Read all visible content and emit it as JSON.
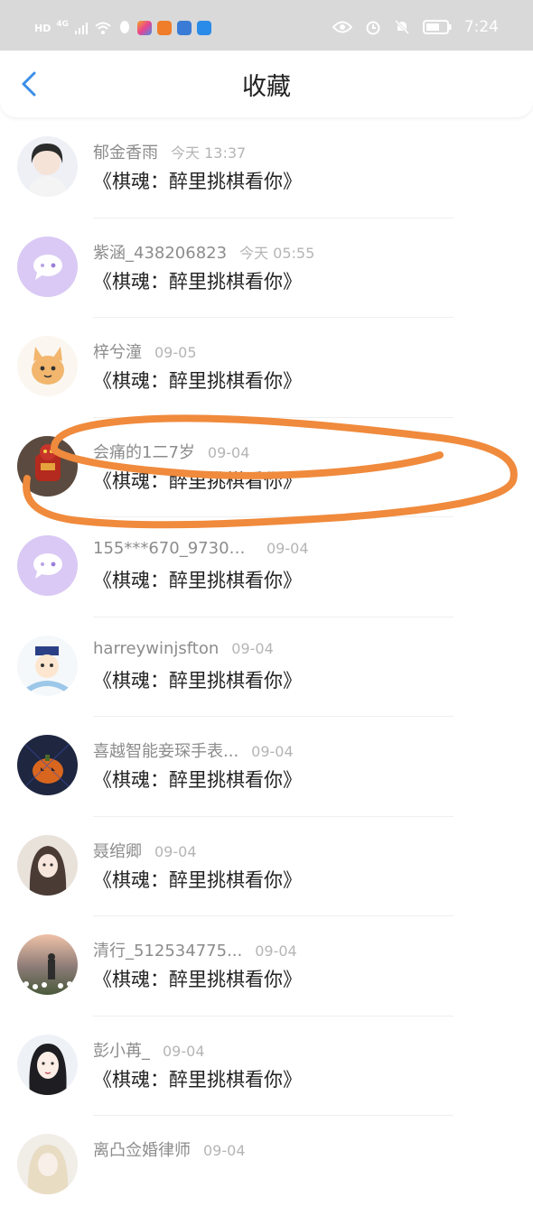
{
  "status_bar": {
    "left_labels": [
      "HD",
      "4G"
    ],
    "time": "7:24",
    "icons": [
      "signal-icon",
      "wifi-icon",
      "qq-icon",
      "app-icon",
      "video-icon",
      "music-icon",
      "weibo-icon",
      "eye-icon",
      "alarm-icon",
      "mute-icon",
      "battery-icon"
    ]
  },
  "header": {
    "title": "收藏"
  },
  "list": [
    {
      "name": "郁金香雨",
      "time": "今天 13:37",
      "content": "《棋魂：醉里挑棋看你》",
      "avatar": "photo-girl"
    },
    {
      "name": "紫涵_438206823",
      "time": "今天 05:55",
      "content": "《棋魂：醉里挑棋看你》",
      "avatar": "default"
    },
    {
      "name": "梓兮潼",
      "time": "09-05",
      "content": "《棋魂：醉里挑棋看你》",
      "avatar": "cat"
    },
    {
      "name": "会痛的1二7岁",
      "time": "09-04",
      "content": "《棋魂：醉里挑棋看你》",
      "avatar": "red-robot"
    },
    {
      "name": "155***670_97305...",
      "time": "09-04",
      "content": "《棋魂：醉里挑棋看你》",
      "avatar": "default"
    },
    {
      "name": "harreywinjsfton",
      "time": "09-04",
      "content": "《棋魂：醉里挑棋看你》",
      "avatar": "cartoon-emperor"
    },
    {
      "name": "喜越智能妾琛手表...",
      "time": "09-04",
      "content": "《棋魂：醉里挑棋看你》",
      "avatar": "pumpkin"
    },
    {
      "name": "聂绾卿",
      "time": "09-04",
      "content": "《棋魂：醉里挑棋看你》",
      "avatar": "ancient-girl"
    },
    {
      "name": "清行_512534775...",
      "time": "09-04",
      "content": "《棋魂：醉里挑棋看你》",
      "avatar": "flower-field"
    },
    {
      "name": "彭小苒_",
      "time": "09-04",
      "content": "《棋魂：醉里挑棋看你》",
      "avatar": "woman-portrait"
    },
    {
      "name": "离凸佥婚律师",
      "time": "09-04",
      "content": "",
      "avatar": "blonde"
    }
  ],
  "colors": {
    "accent": "#3a8ee6",
    "annotation": "#f08a3c",
    "default_avatar": "#d9c9f4"
  }
}
